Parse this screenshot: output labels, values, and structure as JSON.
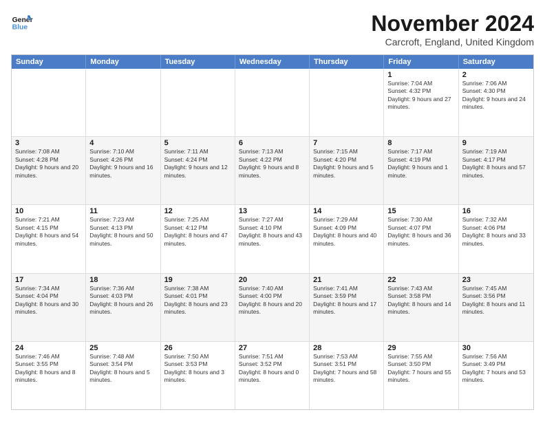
{
  "header": {
    "logo_general": "General",
    "logo_blue": "Blue",
    "main_title": "November 2024",
    "subtitle": "Carcroft, England, United Kingdom"
  },
  "days_of_week": [
    "Sunday",
    "Monday",
    "Tuesday",
    "Wednesday",
    "Thursday",
    "Friday",
    "Saturday"
  ],
  "rows": [
    [
      {
        "day": "",
        "info": ""
      },
      {
        "day": "",
        "info": ""
      },
      {
        "day": "",
        "info": ""
      },
      {
        "day": "",
        "info": ""
      },
      {
        "day": "",
        "info": ""
      },
      {
        "day": "1",
        "info": "Sunrise: 7:04 AM\nSunset: 4:32 PM\nDaylight: 9 hours and 27 minutes."
      },
      {
        "day": "2",
        "info": "Sunrise: 7:06 AM\nSunset: 4:30 PM\nDaylight: 9 hours and 24 minutes."
      }
    ],
    [
      {
        "day": "3",
        "info": "Sunrise: 7:08 AM\nSunset: 4:28 PM\nDaylight: 9 hours and 20 minutes."
      },
      {
        "day": "4",
        "info": "Sunrise: 7:10 AM\nSunset: 4:26 PM\nDaylight: 9 hours and 16 minutes."
      },
      {
        "day": "5",
        "info": "Sunrise: 7:11 AM\nSunset: 4:24 PM\nDaylight: 9 hours and 12 minutes."
      },
      {
        "day": "6",
        "info": "Sunrise: 7:13 AM\nSunset: 4:22 PM\nDaylight: 9 hours and 8 minutes."
      },
      {
        "day": "7",
        "info": "Sunrise: 7:15 AM\nSunset: 4:20 PM\nDaylight: 9 hours and 5 minutes."
      },
      {
        "day": "8",
        "info": "Sunrise: 7:17 AM\nSunset: 4:19 PM\nDaylight: 9 hours and 1 minute."
      },
      {
        "day": "9",
        "info": "Sunrise: 7:19 AM\nSunset: 4:17 PM\nDaylight: 8 hours and 57 minutes."
      }
    ],
    [
      {
        "day": "10",
        "info": "Sunrise: 7:21 AM\nSunset: 4:15 PM\nDaylight: 8 hours and 54 minutes."
      },
      {
        "day": "11",
        "info": "Sunrise: 7:23 AM\nSunset: 4:13 PM\nDaylight: 8 hours and 50 minutes."
      },
      {
        "day": "12",
        "info": "Sunrise: 7:25 AM\nSunset: 4:12 PM\nDaylight: 8 hours and 47 minutes."
      },
      {
        "day": "13",
        "info": "Sunrise: 7:27 AM\nSunset: 4:10 PM\nDaylight: 8 hours and 43 minutes."
      },
      {
        "day": "14",
        "info": "Sunrise: 7:29 AM\nSunset: 4:09 PM\nDaylight: 8 hours and 40 minutes."
      },
      {
        "day": "15",
        "info": "Sunrise: 7:30 AM\nSunset: 4:07 PM\nDaylight: 8 hours and 36 minutes."
      },
      {
        "day": "16",
        "info": "Sunrise: 7:32 AM\nSunset: 4:06 PM\nDaylight: 8 hours and 33 minutes."
      }
    ],
    [
      {
        "day": "17",
        "info": "Sunrise: 7:34 AM\nSunset: 4:04 PM\nDaylight: 8 hours and 30 minutes."
      },
      {
        "day": "18",
        "info": "Sunrise: 7:36 AM\nSunset: 4:03 PM\nDaylight: 8 hours and 26 minutes."
      },
      {
        "day": "19",
        "info": "Sunrise: 7:38 AM\nSunset: 4:01 PM\nDaylight: 8 hours and 23 minutes."
      },
      {
        "day": "20",
        "info": "Sunrise: 7:40 AM\nSunset: 4:00 PM\nDaylight: 8 hours and 20 minutes."
      },
      {
        "day": "21",
        "info": "Sunrise: 7:41 AM\nSunset: 3:59 PM\nDaylight: 8 hours and 17 minutes."
      },
      {
        "day": "22",
        "info": "Sunrise: 7:43 AM\nSunset: 3:58 PM\nDaylight: 8 hours and 14 minutes."
      },
      {
        "day": "23",
        "info": "Sunrise: 7:45 AM\nSunset: 3:56 PM\nDaylight: 8 hours and 11 minutes."
      }
    ],
    [
      {
        "day": "24",
        "info": "Sunrise: 7:46 AM\nSunset: 3:55 PM\nDaylight: 8 hours and 8 minutes."
      },
      {
        "day": "25",
        "info": "Sunrise: 7:48 AM\nSunset: 3:54 PM\nDaylight: 8 hours and 5 minutes."
      },
      {
        "day": "26",
        "info": "Sunrise: 7:50 AM\nSunset: 3:53 PM\nDaylight: 8 hours and 3 minutes."
      },
      {
        "day": "27",
        "info": "Sunrise: 7:51 AM\nSunset: 3:52 PM\nDaylight: 8 hours and 0 minutes."
      },
      {
        "day": "28",
        "info": "Sunrise: 7:53 AM\nSunset: 3:51 PM\nDaylight: 7 hours and 58 minutes."
      },
      {
        "day": "29",
        "info": "Sunrise: 7:55 AM\nSunset: 3:50 PM\nDaylight: 7 hours and 55 minutes."
      },
      {
        "day": "30",
        "info": "Sunrise: 7:56 AM\nSunset: 3:49 PM\nDaylight: 7 hours and 53 minutes."
      }
    ]
  ]
}
